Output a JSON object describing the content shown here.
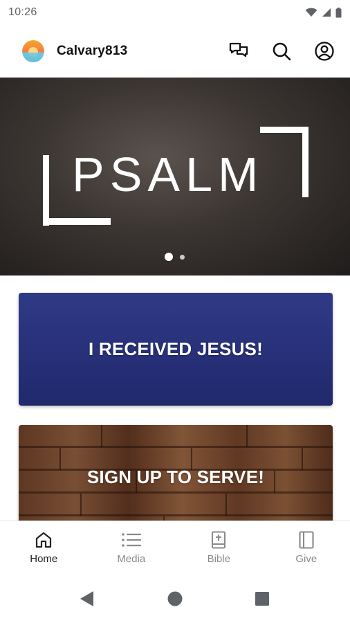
{
  "status": {
    "time": "10:26"
  },
  "app_bar": {
    "title": "Calvary813"
  },
  "hero": {
    "word": "PSALM",
    "slide_count": 2,
    "active_slide": 1
  },
  "cards": [
    {
      "label": "I RECEIVED JESUS!"
    },
    {
      "label": "SIGN UP TO SERVE!"
    }
  ],
  "bottom_nav": {
    "items": [
      {
        "label": "Home",
        "icon": "home-icon",
        "active": true
      },
      {
        "label": "Media",
        "icon": "list-icon",
        "active": false
      },
      {
        "label": "Bible",
        "icon": "bible-icon",
        "active": false
      },
      {
        "label": "Give",
        "icon": "book-icon",
        "active": false
      }
    ]
  },
  "colors": {
    "card_blue": "#28317a",
    "hero_dark": "#3b3532",
    "active_nav": "#222222",
    "inactive_nav": "#8a8a8a"
  }
}
